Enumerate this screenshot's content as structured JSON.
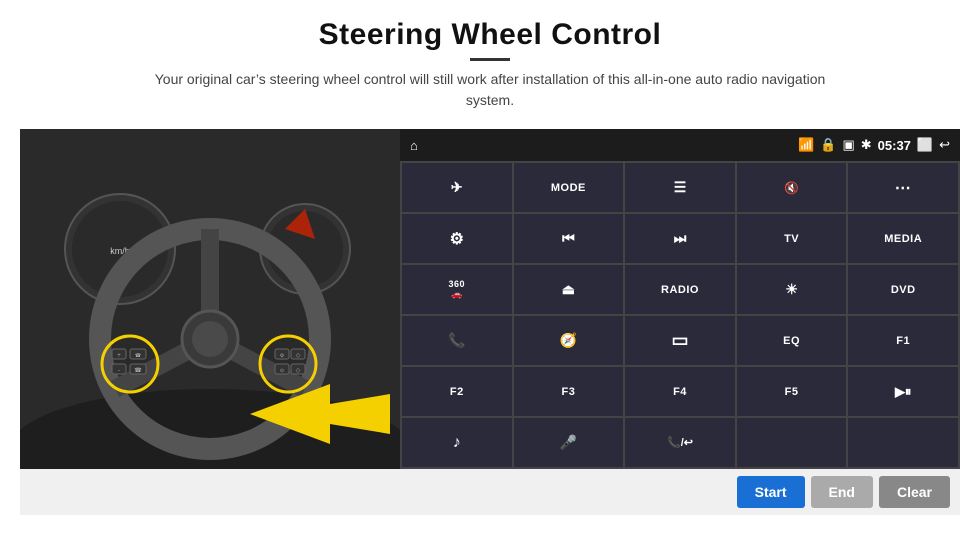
{
  "header": {
    "title": "Steering Wheel Control",
    "divider": true,
    "subtitle": "Your original car’s steering wheel control will still work after installation of this all-in-one auto radio navigation system."
  },
  "status_bar": {
    "time": "05:37",
    "icons": [
      "home",
      "wifi",
      "lock",
      "sd",
      "bluetooth",
      "cast",
      "back"
    ]
  },
  "grid_buttons": [
    {
      "id": "btn-nav",
      "icon": "✈",
      "text": "",
      "row": 1,
      "col": 1
    },
    {
      "id": "btn-mode",
      "icon": "",
      "text": "MODE",
      "row": 1,
      "col": 2
    },
    {
      "id": "btn-list",
      "icon": "☰",
      "text": "",
      "row": 1,
      "col": 3
    },
    {
      "id": "btn-mute",
      "icon": "🔇",
      "text": "",
      "row": 1,
      "col": 4
    },
    {
      "id": "btn-apps",
      "icon": "⋯",
      "text": "",
      "row": 1,
      "col": 5
    },
    {
      "id": "btn-settings",
      "icon": "⚙",
      "text": "",
      "row": 2,
      "col": 1
    },
    {
      "id": "btn-prev",
      "icon": "⏮",
      "text": "",
      "row": 2,
      "col": 2
    },
    {
      "id": "btn-next",
      "icon": "⏭",
      "text": "",
      "row": 2,
      "col": 3
    },
    {
      "id": "btn-tv",
      "icon": "",
      "text": "TV",
      "row": 2,
      "col": 4
    },
    {
      "id": "btn-media",
      "icon": "",
      "text": "MEDIA",
      "row": 2,
      "col": 5
    },
    {
      "id": "btn-360",
      "icon": "",
      "text": "360",
      "row": 3,
      "col": 1
    },
    {
      "id": "btn-eject",
      "icon": "⏏",
      "text": "",
      "row": 3,
      "col": 2
    },
    {
      "id": "btn-radio",
      "icon": "",
      "text": "RADIO",
      "row": 3,
      "col": 3
    },
    {
      "id": "btn-bright",
      "icon": "☀",
      "text": "",
      "row": 3,
      "col": 4
    },
    {
      "id": "btn-dvd",
      "icon": "",
      "text": "DVD",
      "row": 3,
      "col": 5
    },
    {
      "id": "btn-phone",
      "icon": "📞",
      "text": "",
      "row": 4,
      "col": 1
    },
    {
      "id": "btn-navi",
      "icon": "🧭",
      "text": "",
      "row": 4,
      "col": 2
    },
    {
      "id": "btn-screen",
      "icon": "▭",
      "text": "",
      "row": 4,
      "col": 3
    },
    {
      "id": "btn-eq",
      "icon": "",
      "text": "EQ",
      "row": 4,
      "col": 4
    },
    {
      "id": "btn-f1",
      "icon": "",
      "text": "F1",
      "row": 4,
      "col": 5
    },
    {
      "id": "btn-f2",
      "icon": "",
      "text": "F2",
      "row": 5,
      "col": 1
    },
    {
      "id": "btn-f3",
      "icon": "",
      "text": "F3",
      "row": 5,
      "col": 2
    },
    {
      "id": "btn-f4",
      "icon": "",
      "text": "F4",
      "row": 5,
      "col": 3
    },
    {
      "id": "btn-f5",
      "icon": "",
      "text": "F5",
      "row": 5,
      "col": 4
    },
    {
      "id": "btn-playpause",
      "icon": "▶⏸",
      "text": "",
      "row": 5,
      "col": 5
    },
    {
      "id": "btn-music",
      "icon": "♪",
      "text": "",
      "row": 6,
      "col": 1
    },
    {
      "id": "btn-mic",
      "icon": "🎤",
      "text": "",
      "row": 6,
      "col": 2
    },
    {
      "id": "btn-volphone",
      "icon": "📞",
      "text": "",
      "row": 6,
      "col": 3
    },
    {
      "id": "btn-empty1",
      "icon": "",
      "text": "",
      "row": 6,
      "col": 4
    },
    {
      "id": "btn-empty2",
      "icon": "",
      "text": "",
      "row": 6,
      "col": 5
    }
  ],
  "bottom_bar": {
    "start_label": "Start",
    "end_label": "End",
    "clear_label": "Clear"
  }
}
